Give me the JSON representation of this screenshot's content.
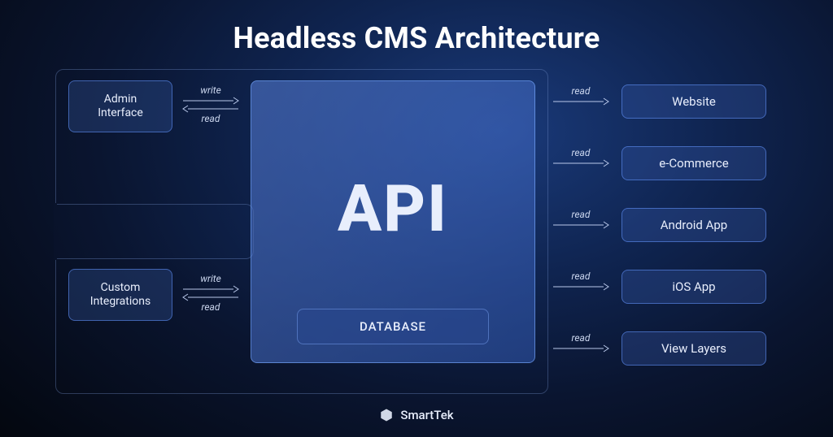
{
  "title": "Headless CMS Architecture",
  "left": {
    "admin": "Admin\nInterface",
    "custom": "Custom\nIntegrations",
    "write": "write",
    "read": "read"
  },
  "api": {
    "label": "API",
    "database": "DATABASE"
  },
  "right": {
    "read": "read",
    "consumers": [
      "Website",
      "e-Commerce",
      "Android App",
      "iOS App",
      "View Layers"
    ]
  },
  "brand": "SmartTek"
}
